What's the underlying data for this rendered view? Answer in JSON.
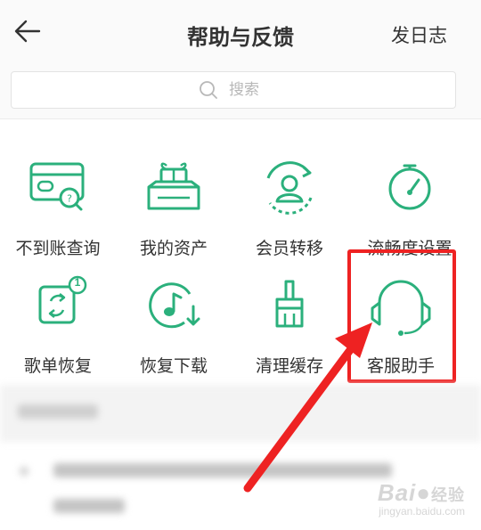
{
  "header": {
    "title": "帮助与反馈",
    "action_label": "发日志",
    "back_icon": "back-arrow-icon"
  },
  "search": {
    "placeholder": "搜索",
    "icon": "search-icon"
  },
  "grid": {
    "items": [
      {
        "label": "不到账查询",
        "icon": "card-search-icon"
      },
      {
        "label": "我的资产",
        "icon": "gift-box-icon"
      },
      {
        "label": "会员转移",
        "icon": "member-transfer-icon"
      },
      {
        "label": "流畅度设置",
        "icon": "speedometer-icon"
      },
      {
        "label": "歌单恢复",
        "icon": "playlist-restore-icon",
        "badge": "1"
      },
      {
        "label": "恢复下载",
        "icon": "music-download-icon"
      },
      {
        "label": "清理缓存",
        "icon": "brush-icon"
      },
      {
        "label": "客服助手",
        "icon": "headset-icon"
      }
    ]
  },
  "watermark": {
    "logo": "Bai",
    "logo_suffix": "经验",
    "url": "jingyan.baidu.com"
  },
  "colors": {
    "accent": "#2bb07c",
    "annotation": "#ee2222",
    "header_bg": "#fafafa"
  }
}
